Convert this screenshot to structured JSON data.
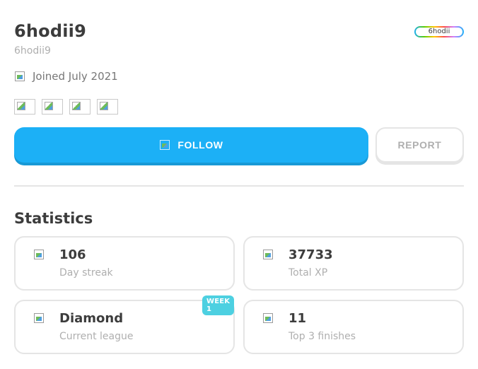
{
  "profile": {
    "username": "6hodii9",
    "handle": "6hodii9",
    "joined": "Joined July 2021",
    "avatar_text": "6hodii",
    "flag_count": 4
  },
  "actions": {
    "follow_label": "FOLLOW",
    "report_label": "REPORT"
  },
  "statistics": {
    "title": "Statistics",
    "cards": [
      {
        "value": "106",
        "label": "Day streak",
        "icon": "streak-icon"
      },
      {
        "value": "37733",
        "label": "Total XP",
        "icon": "xp-icon"
      },
      {
        "value": "Diamond",
        "label": "Current league",
        "icon": "league-icon",
        "badge": "WEEK 1"
      },
      {
        "value": "11",
        "label": "Top 3 finishes",
        "icon": "medal-icon"
      }
    ]
  },
  "colors": {
    "primary": "#1cb0f6",
    "text": "#3c3c3c",
    "muted": "#afafaf",
    "border": "#e5e5e5",
    "badge": "#4dd0e1"
  }
}
